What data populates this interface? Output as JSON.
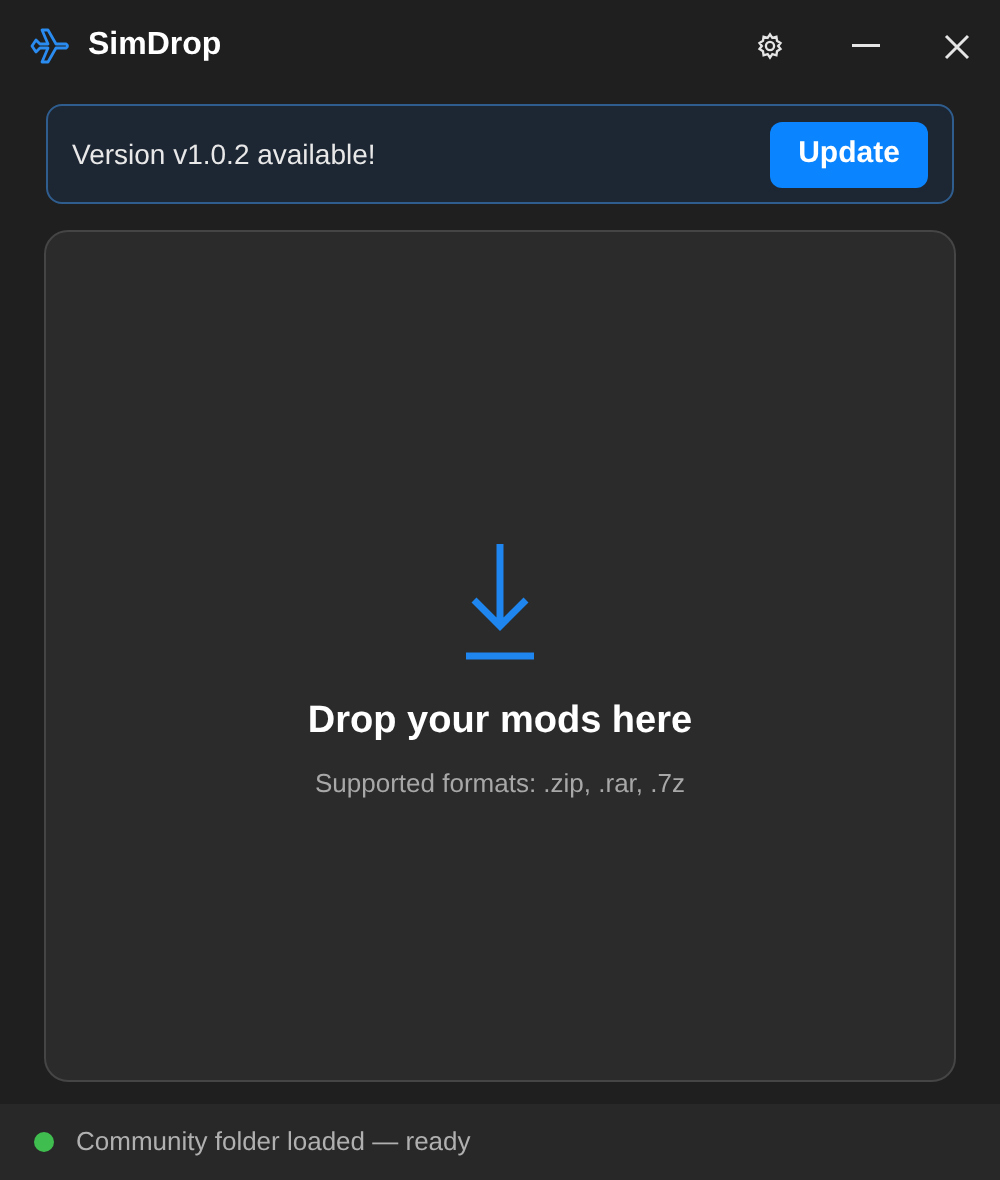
{
  "window": {
    "title": "SimDrop"
  },
  "update_banner": {
    "message": "Version v1.0.2 available!",
    "button": "Update"
  },
  "drop_zone": {
    "title": "Drop your mods here",
    "subtitle": "Supported formats: .zip, .rar, .7z"
  },
  "status_bar": {
    "text": "Community folder loaded — ready",
    "color": "#3fbe4f"
  }
}
